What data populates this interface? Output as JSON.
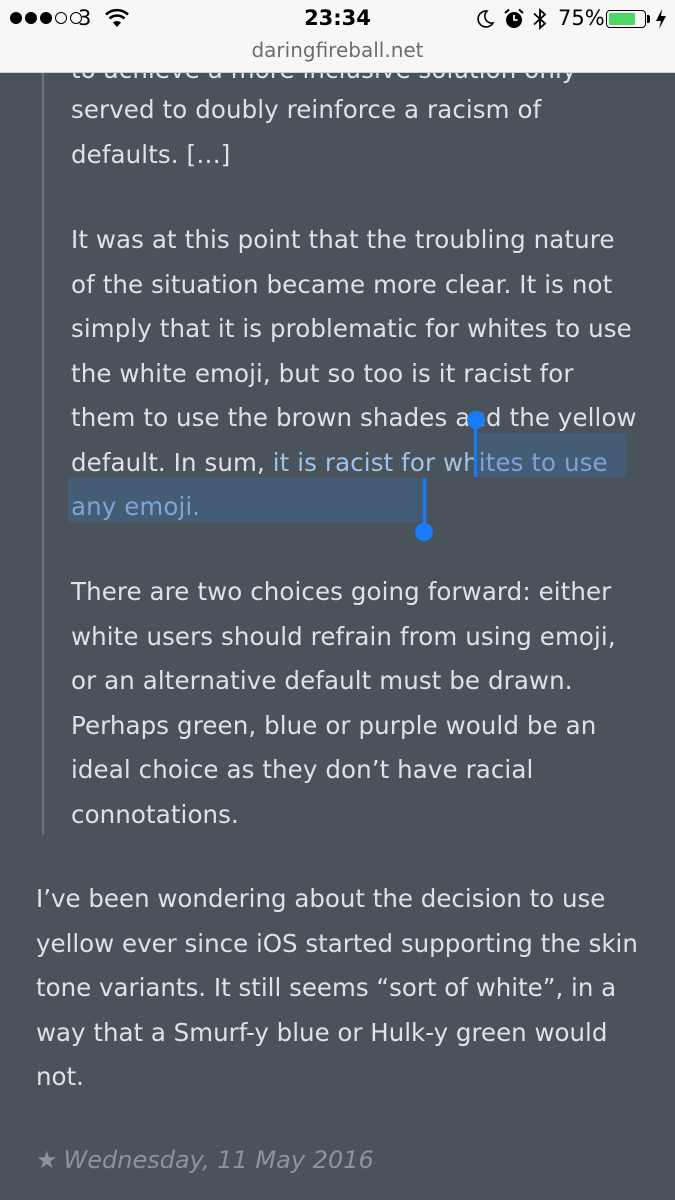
{
  "status_bar": {
    "carrier": "3",
    "time": "23:34",
    "battery_percent": "75%",
    "battery_level": 0.75,
    "icons": [
      "signal-dots-icon",
      "wifi-icon",
      "moon-icon",
      "alarm-icon",
      "bluetooth-icon",
      "battery-icon",
      "charging-bolt-icon"
    ]
  },
  "browser": {
    "url": "daringfireball.net"
  },
  "quote": {
    "partial_line": "to achieve a more inclusive solution only",
    "p0_line1": "served to doubly reinforce a racism of",
    "p0_line2": "defaults. […]",
    "p1_before": "It was at this point that the troubling nature of the situation became more clear. It is not simply that it is problematic for whites to use the white emoji, but so too is it racist for them to use the brown shades and the yellow default. In sum, ",
    "p1_selected": "it is racist for whites to use any emoji.",
    "p2": "There are two choices going forward: either white users should refrain from using emoji, or an alternative default must be drawn. Perhaps green, blue or purple would be an ideal choice as they don’t have racial connotations."
  },
  "commentary": "I’ve been wondering about the decision to use yellow ever since iOS started supporting the skin tone variants. It still seems “sort of white”, in a way that a Smurf-y blue or Hulk-y green would not.",
  "dateline": {
    "star": "★",
    "date": "Wednesday, 11 May 2016"
  },
  "colors": {
    "background": "#4a535c",
    "text": "#dfe2e5",
    "selection": "#3c6eaa",
    "handle": "#1a7cf5"
  }
}
